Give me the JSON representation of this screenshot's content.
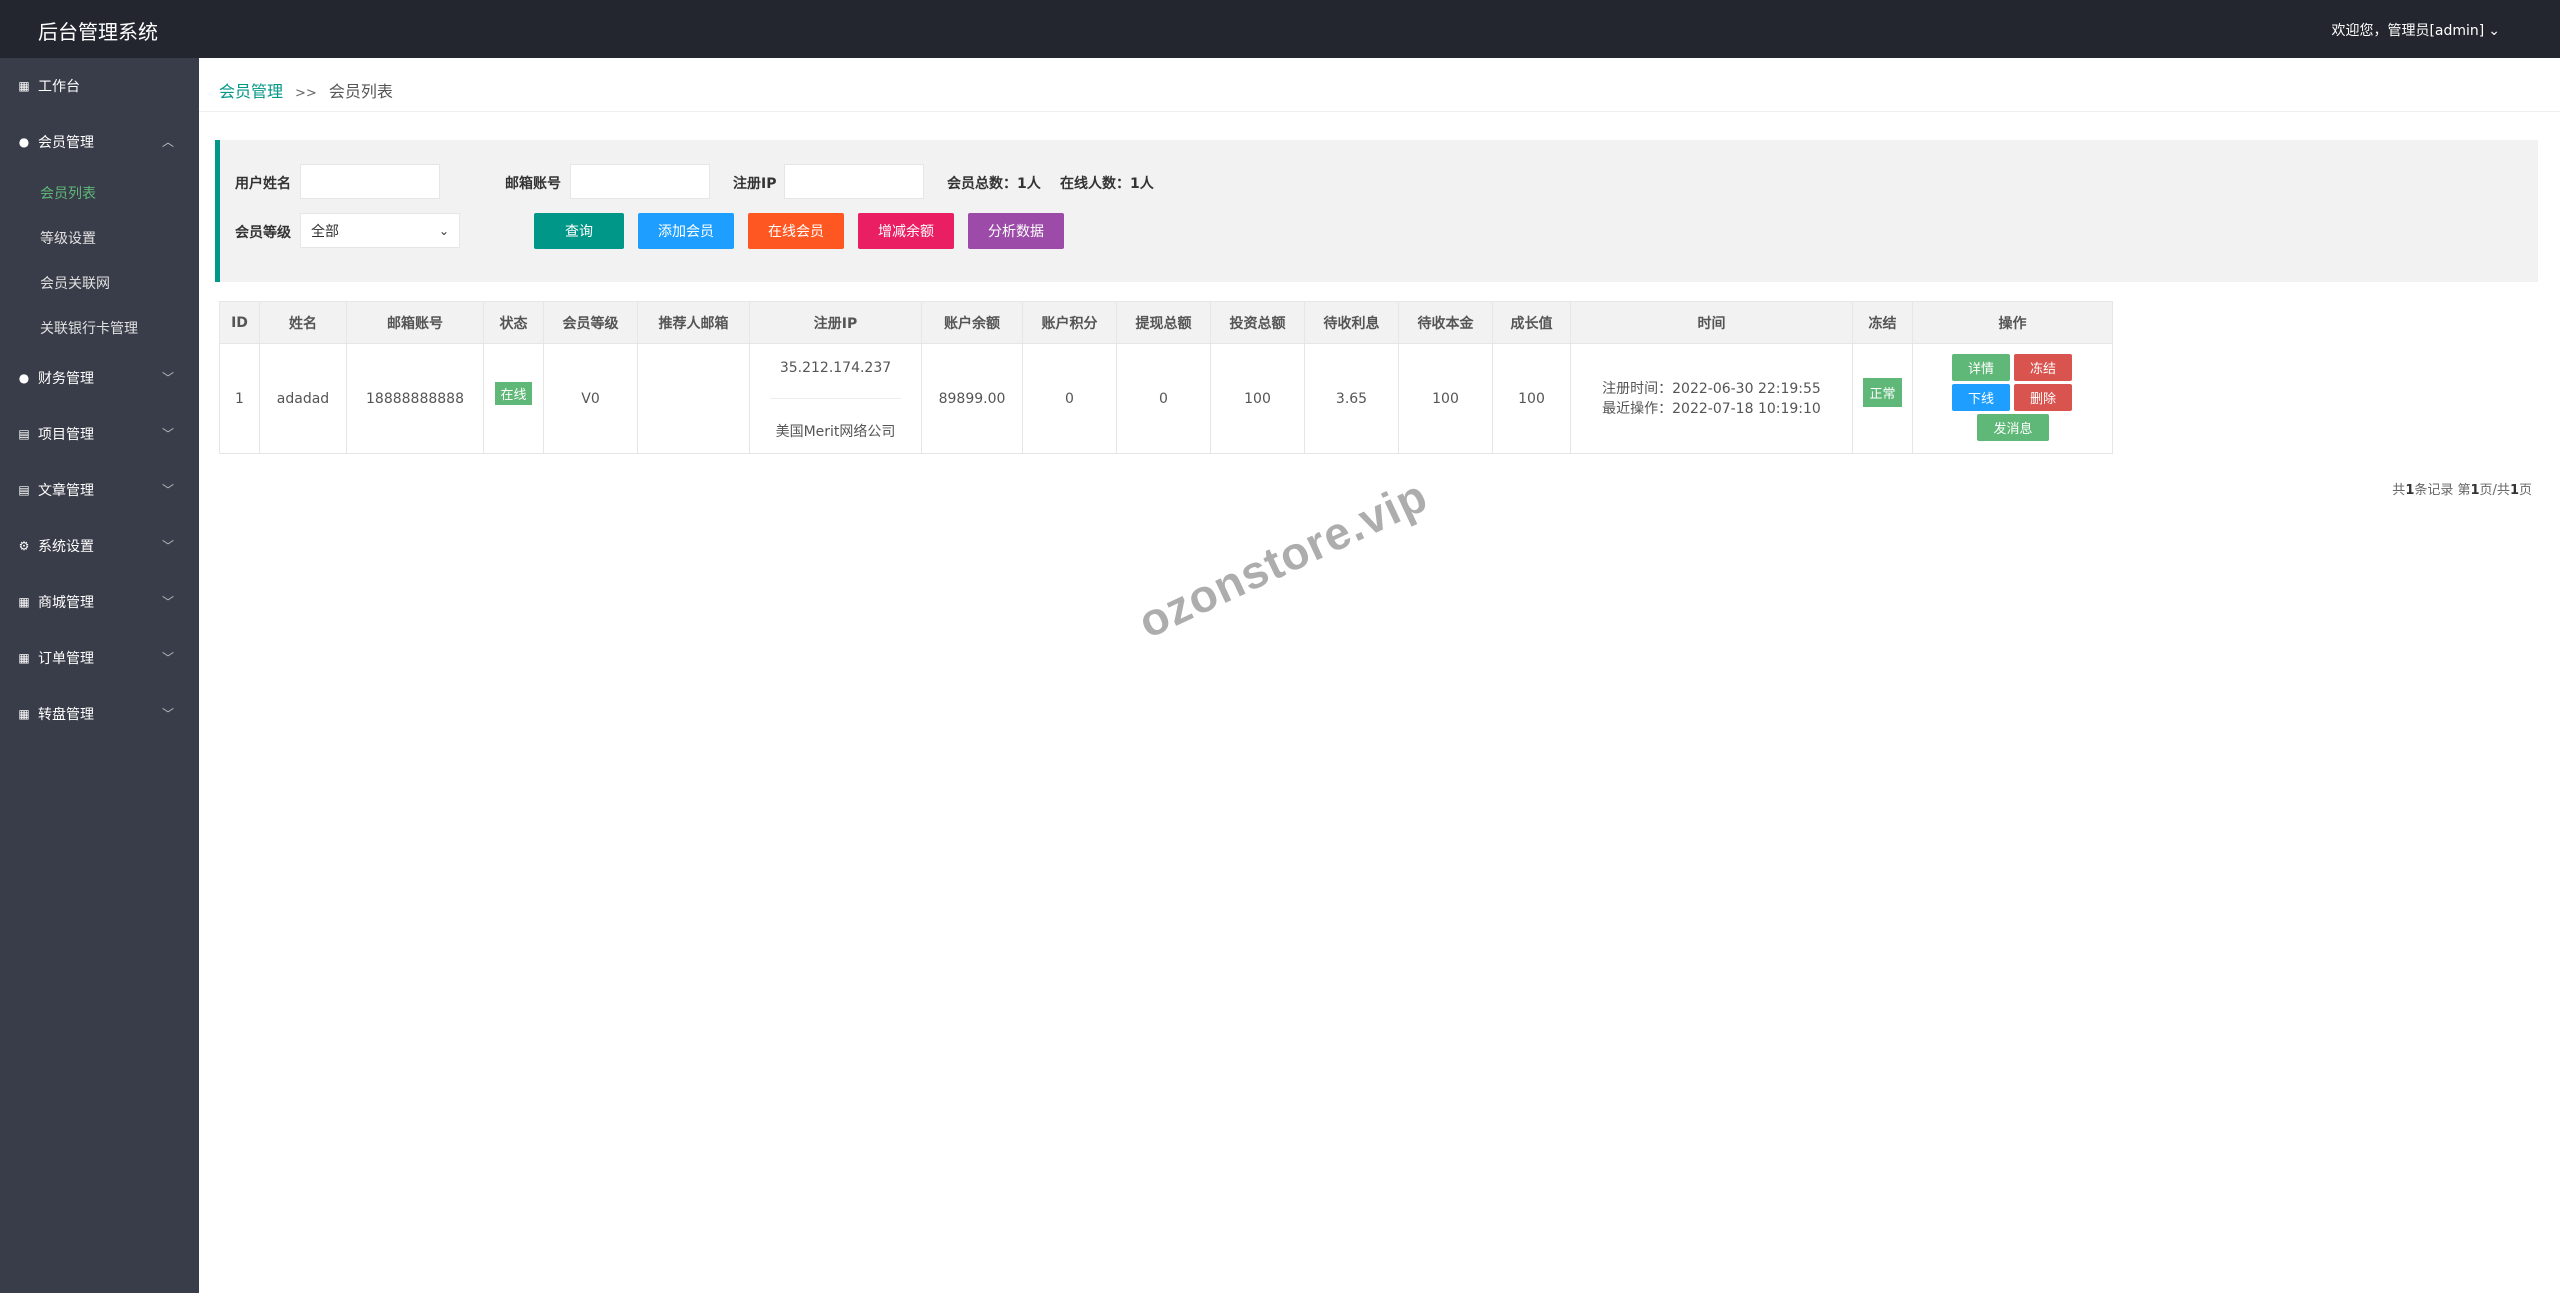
{
  "header": {
    "brand": "后台管理系统",
    "welcome": "欢迎您，管理员[admin]",
    "caret_icon": "chevron-down-icon"
  },
  "sidebar": {
    "workbench": "工作台",
    "member": {
      "label": "会员管理",
      "sub": [
        "会员列表",
        "等级设置",
        "会员关联网",
        "关联银行卡管理"
      ]
    },
    "items": [
      "财务管理",
      "项目管理",
      "文章管理",
      "系统设置",
      "商城管理",
      "订单管理",
      "转盘管理"
    ]
  },
  "breadcrumb": {
    "parent": "会员管理",
    "sep": ">>",
    "current": "会员列表"
  },
  "filter": {
    "username_label": "用户姓名",
    "username_value": "",
    "email_label": "邮箱账号",
    "email_value": "",
    "ip_label": "注册IP",
    "ip_value": "",
    "total_label": "会员总数：1人",
    "online_label": "在线人数：1人",
    "level_label": "会员等级",
    "level_value": "全部",
    "buttons": {
      "query": "查询",
      "add": "添加会员",
      "online": "在线会员",
      "balance": "增减余额",
      "analyze": "分析数据"
    }
  },
  "table": {
    "columns": [
      "ID",
      "姓名",
      "邮箱账号",
      "状态",
      "会员等级",
      "推荐人邮箱",
      "注册IP",
      "账户余额",
      "账户积分",
      "提现总额",
      "投资总额",
      "待收利息",
      "待收本金",
      "成长值",
      "时间",
      "冻结",
      "操作"
    ],
    "rows": [
      {
        "id": "1",
        "name": "adadad",
        "email": "18888888888",
        "status": "在线",
        "level": "V0",
        "referrer": "",
        "ip": "35.212.174.237",
        "ip_location": "美国Merit网络公司",
        "balance": "89899.00",
        "points": "0",
        "withdraw": "0",
        "invest": "100",
        "interest": "3.65",
        "principal": "100",
        "growth": "100",
        "reg_time": "注册时间：2022-06-30 22:19:55",
        "last_time": "最近操作：2022-07-18 10:19:10",
        "frozen": "正常",
        "actions": {
          "detail": "详情",
          "freeze": "冻结",
          "offline": "下线",
          "delete": "删除",
          "message": "发消息"
        }
      }
    ]
  },
  "pager": {
    "text_prefix": "共",
    "count": "1",
    "text_mid1": "条记录 第",
    "page": "1",
    "text_mid2": "页/共",
    "pages": "1",
    "text_suffix": "页"
  },
  "watermark": "ozonstore.vip",
  "colors": {
    "topbar": "#23262e",
    "sidebar": "#393d49",
    "teal": "#009688",
    "blue": "#1e9fff",
    "orange": "#ff5722",
    "pink": "#e91e63",
    "purple": "#9c4ba8",
    "green": "#5fb878",
    "red": "#d9534f"
  }
}
